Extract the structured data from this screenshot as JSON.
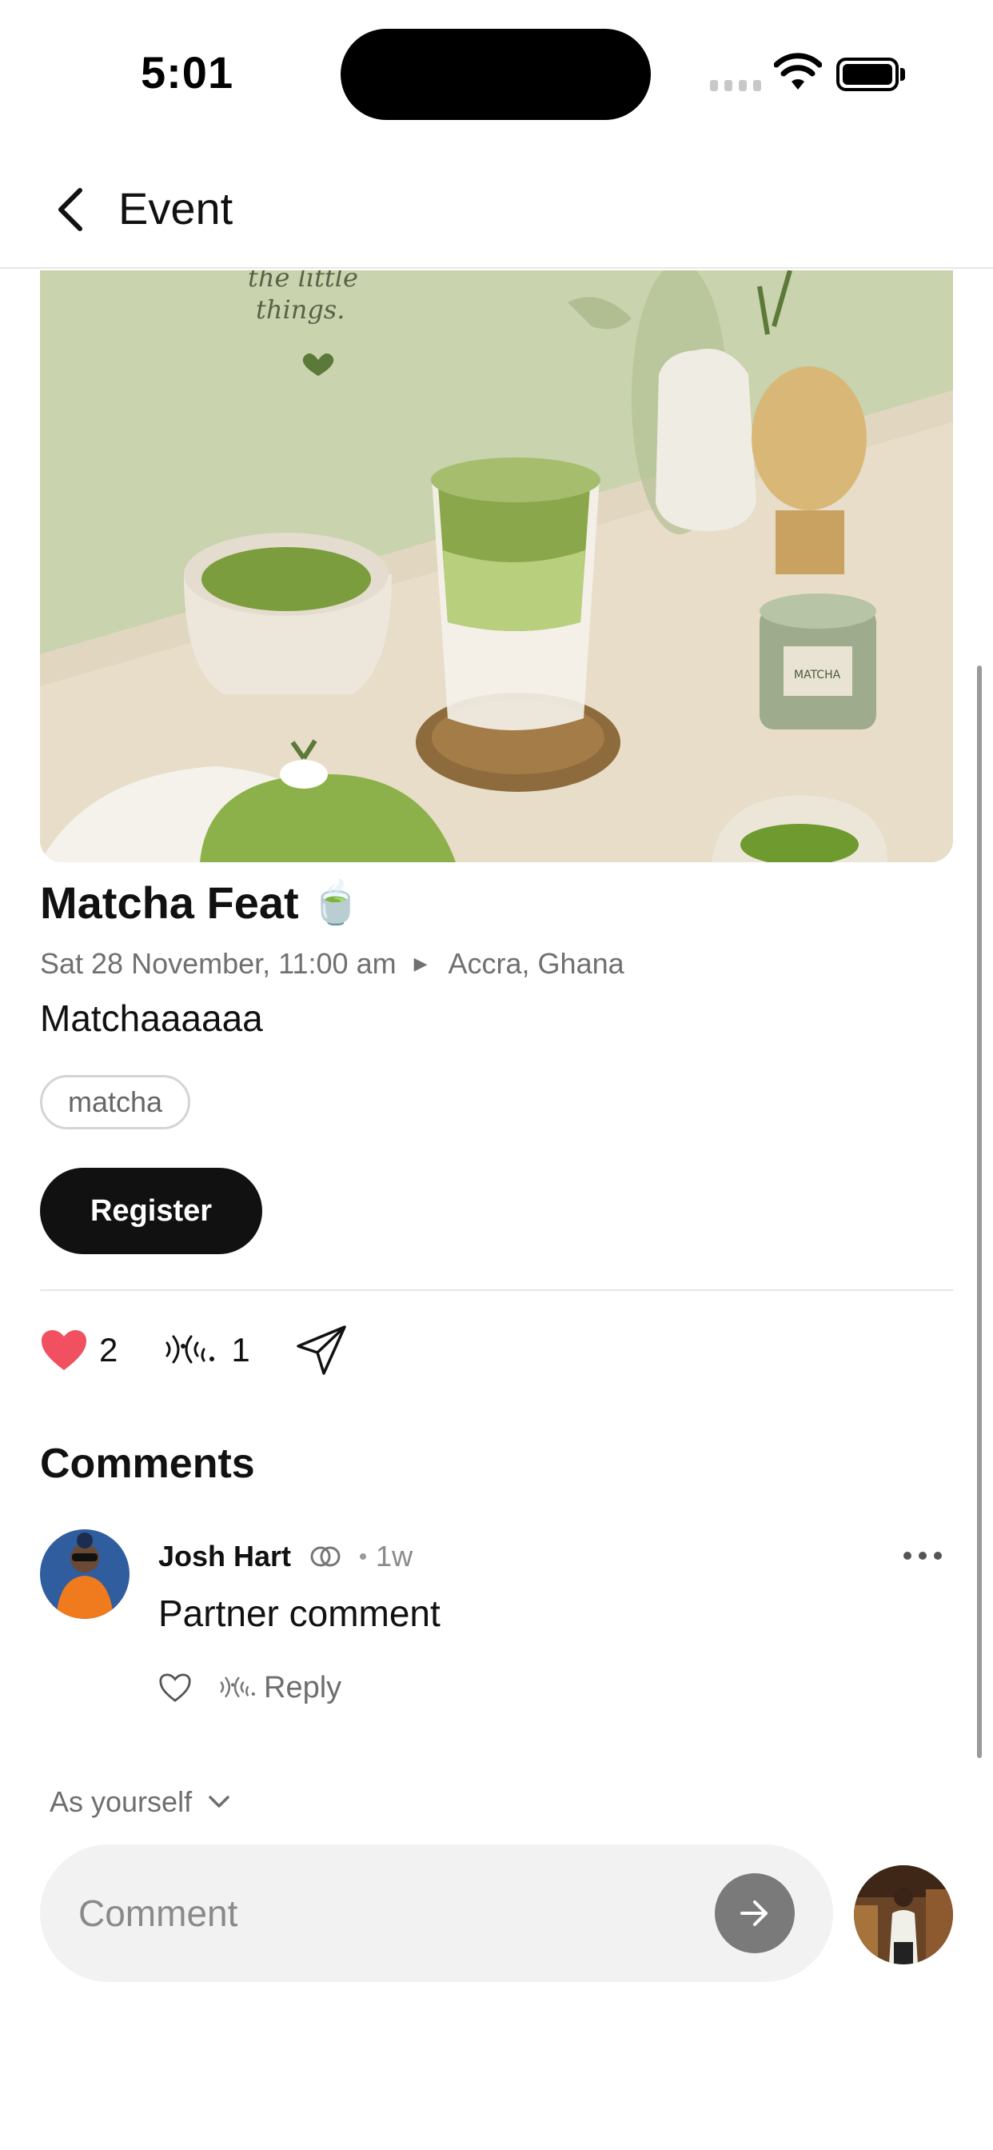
{
  "status_bar": {
    "time": "5:01"
  },
  "header": {
    "title": "Event"
  },
  "hero_art": {
    "caption_line1": "the little",
    "caption_line2": "things.",
    "tin_label": "MATCHA"
  },
  "event": {
    "title": "Matcha Feat",
    "title_emoji": "🍵",
    "date": "Sat 28 November, 11:00 am",
    "location": "Accra, Ghana",
    "description": "Matchaaaaaa",
    "tags": [
      "matcha"
    ],
    "register_label": "Register"
  },
  "actions": {
    "likes": "2",
    "echoes": "1"
  },
  "comments": {
    "heading": "Comments",
    "items": [
      {
        "author": "Josh Hart",
        "time": "1w",
        "text": "Partner comment",
        "reply_label": "Reply"
      }
    ]
  },
  "composer": {
    "identity_label": "As yourself",
    "placeholder": "Comment"
  },
  "colors": {
    "accent": "#111111",
    "like": "#f0505f",
    "muted_text": "#707070",
    "composer_bg": "#f2f2f2"
  },
  "icons": [
    "back-icon",
    "wifi-icon",
    "battery-icon",
    "heart-filled-icon",
    "echo-icon",
    "send-plane-icon",
    "partner-icon",
    "more-icon",
    "heart-outline-icon",
    "chevron-down-icon",
    "arrow-right-icon"
  ]
}
